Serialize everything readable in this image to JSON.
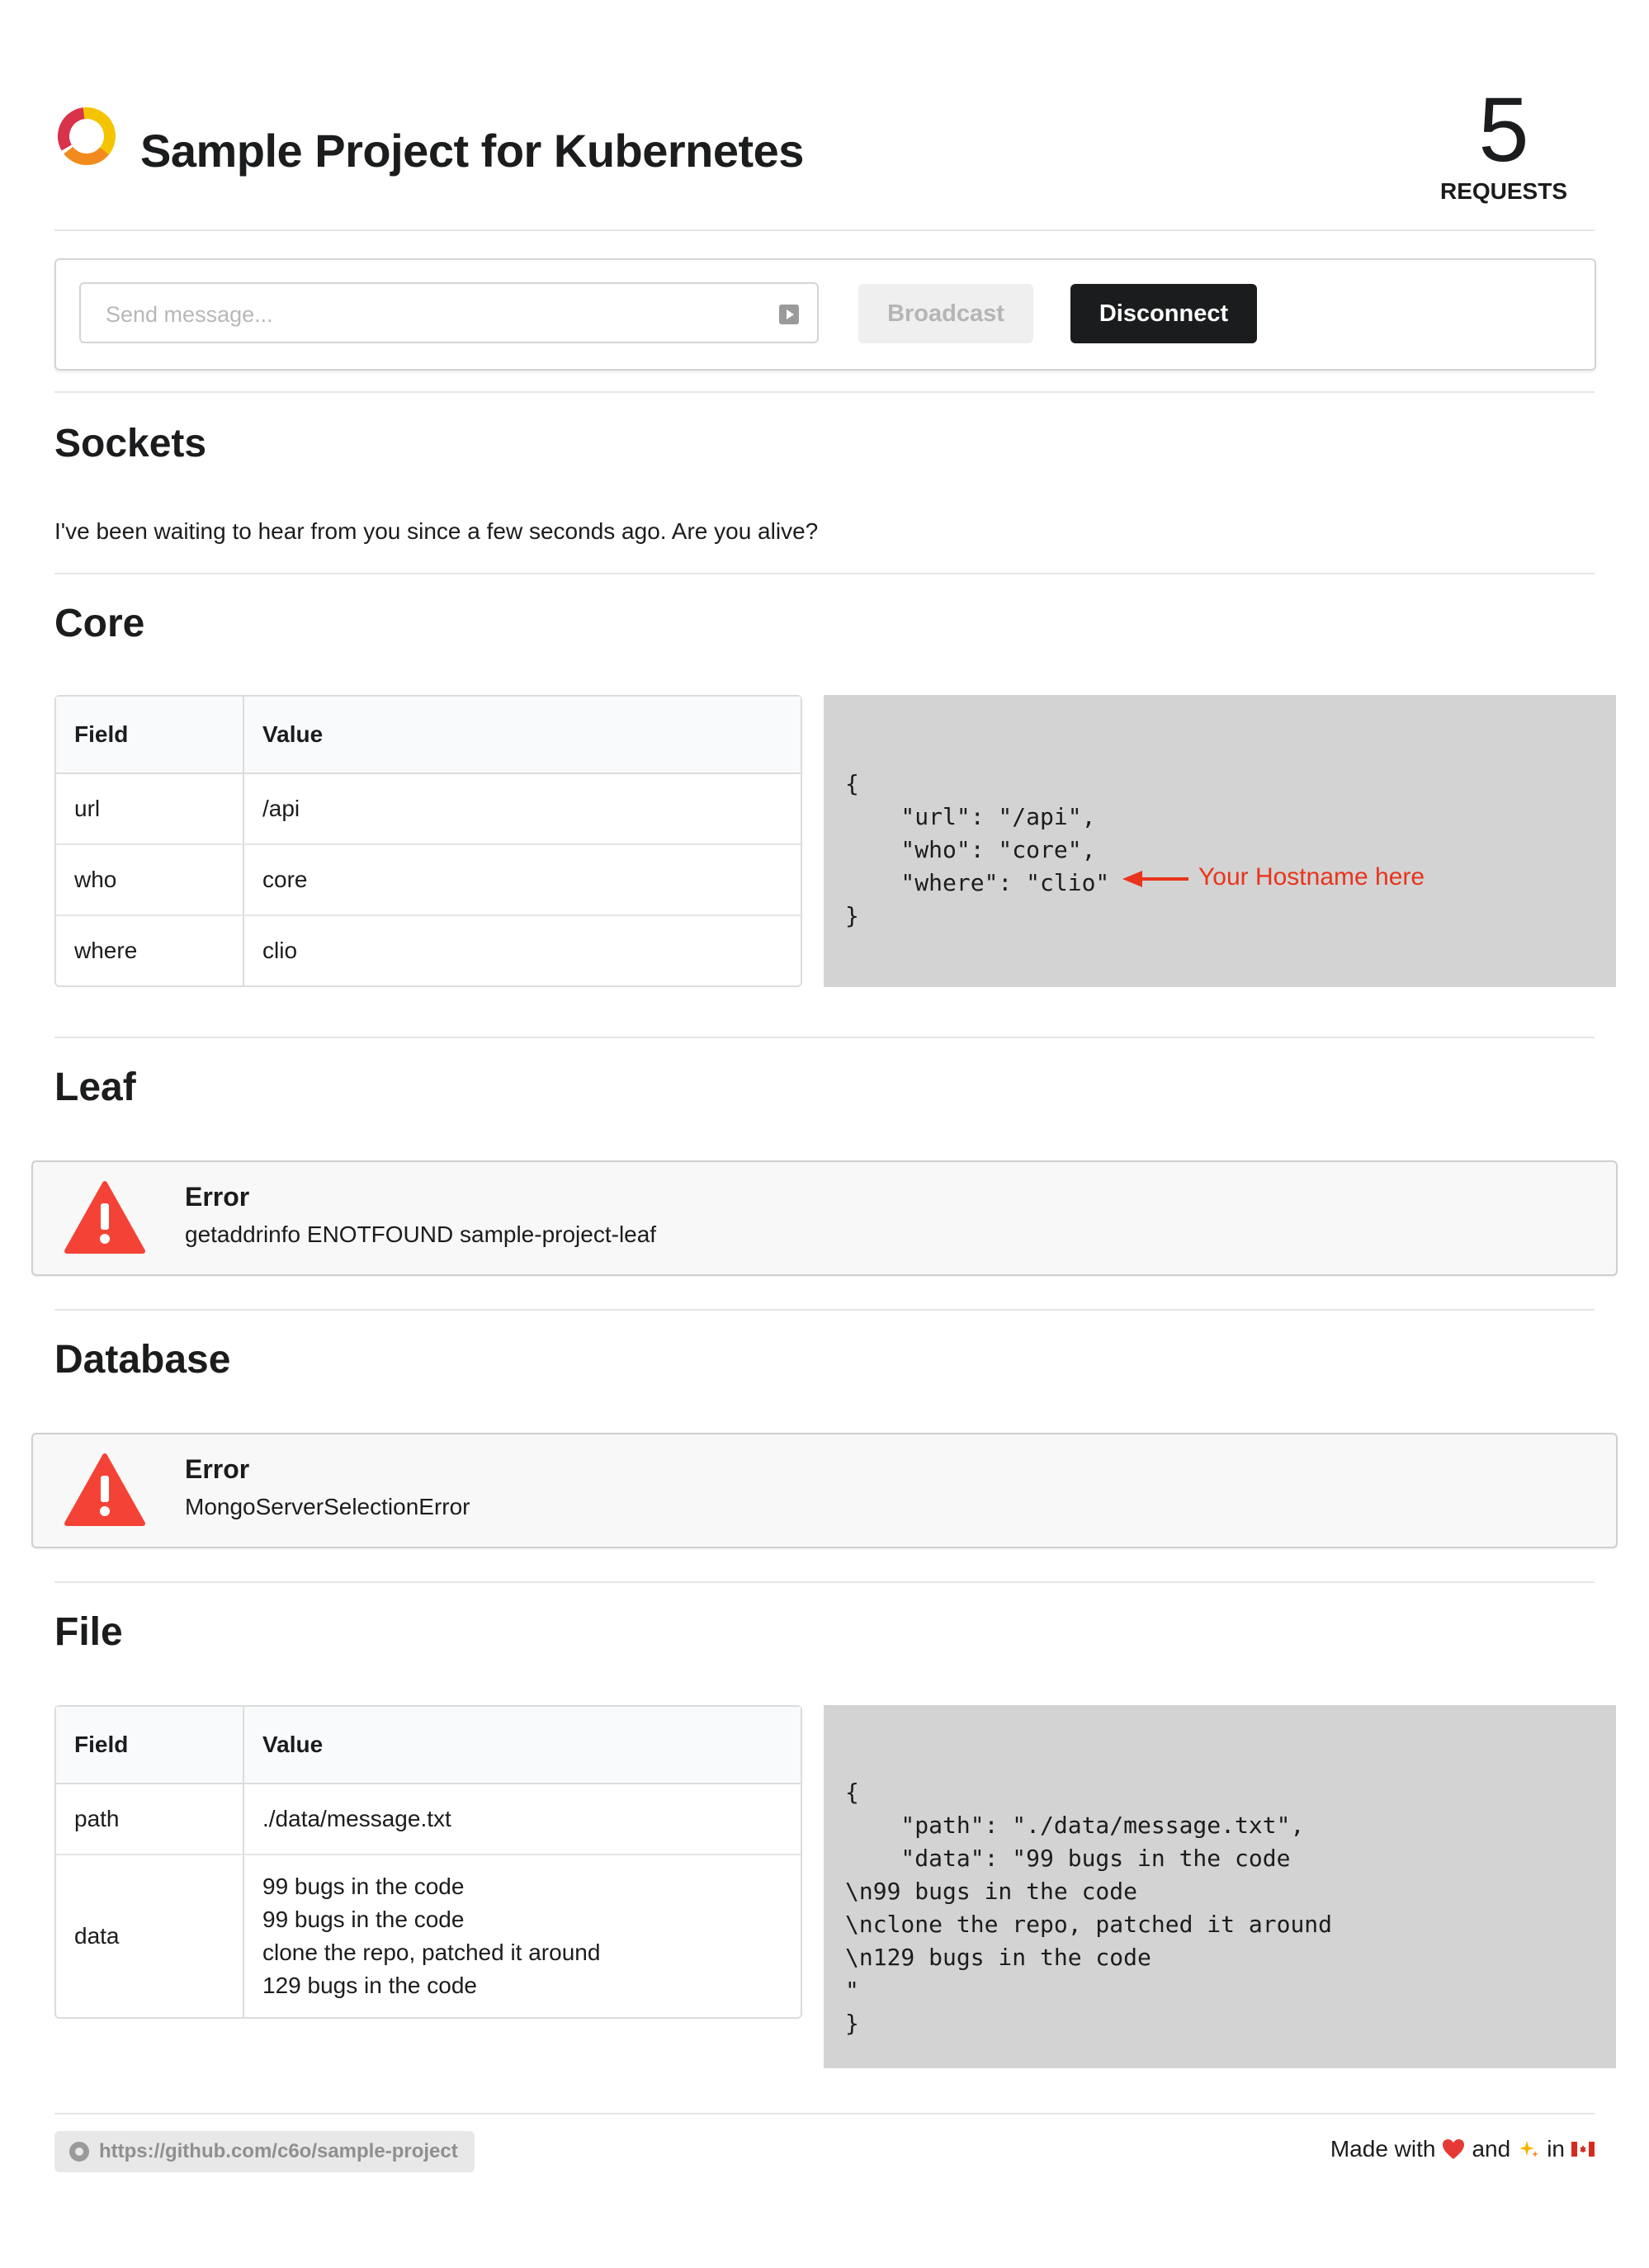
{
  "header": {
    "title": "Sample Project for Kubernetes",
    "requests_count": "5",
    "requests_label": "REQUESTS"
  },
  "message_bar": {
    "placeholder": "Send message...",
    "broadcast_label": "Broadcast",
    "disconnect_label": "Disconnect"
  },
  "sockets": {
    "heading": "Sockets",
    "text": "I've been waiting to hear from you since a few seconds ago. Are you alive?"
  },
  "core": {
    "heading": "Core",
    "table": {
      "headers": [
        "Field",
        "Value"
      ],
      "rows": [
        {
          "field": "url",
          "value": "/api"
        },
        {
          "field": "who",
          "value": "core"
        },
        {
          "field": "where",
          "value": "clio"
        }
      ]
    },
    "json_lines": [
      "{",
      "    \"url\": \"/api\",",
      "    \"who\": \"core\",",
      "    \"where\": \"clio\"",
      "}"
    ],
    "annotation": "Your Hostname here",
    "annotation_color": "#e8341c"
  },
  "leaf": {
    "heading": "Leaf",
    "error_title": "Error",
    "error_message": "getaddrinfo ENOTFOUND sample-project-leaf"
  },
  "database": {
    "heading": "Database",
    "error_title": "Error",
    "error_message": "MongoServerSelectionError"
  },
  "file": {
    "heading": "File",
    "table": {
      "headers": [
        "Field",
        "Value"
      ],
      "rows": [
        {
          "field": "path",
          "value": "./data/message.txt"
        },
        {
          "field": "data",
          "value_lines": [
            "99 bugs in the code",
            "99 bugs in the code",
            "clone the repo, patched it around",
            "129 bugs in the code"
          ]
        }
      ]
    },
    "json_lines": [
      "{",
      "    \"path\": \"./data/message.txt\",",
      "    \"data\": \"99 bugs in the code",
      "\\n99 bugs in the code",
      "\\nclone the repo, patched it around",
      "\\n129 bugs in the code",
      "\"",
      "}"
    ]
  },
  "footer": {
    "repo_link": "https://github.com/c6o/sample-project",
    "made_with_prefix": "Made with",
    "made_with_and": "and",
    "made_with_in": "in",
    "icons": [
      "github-icon",
      "heart-icon",
      "sparkles-icon",
      "canada-flag-icon"
    ]
  },
  "colors": {
    "error_red": "#f44336",
    "disconnect_bg": "#1b1c1d",
    "code_bg": "#d3d3d3"
  }
}
